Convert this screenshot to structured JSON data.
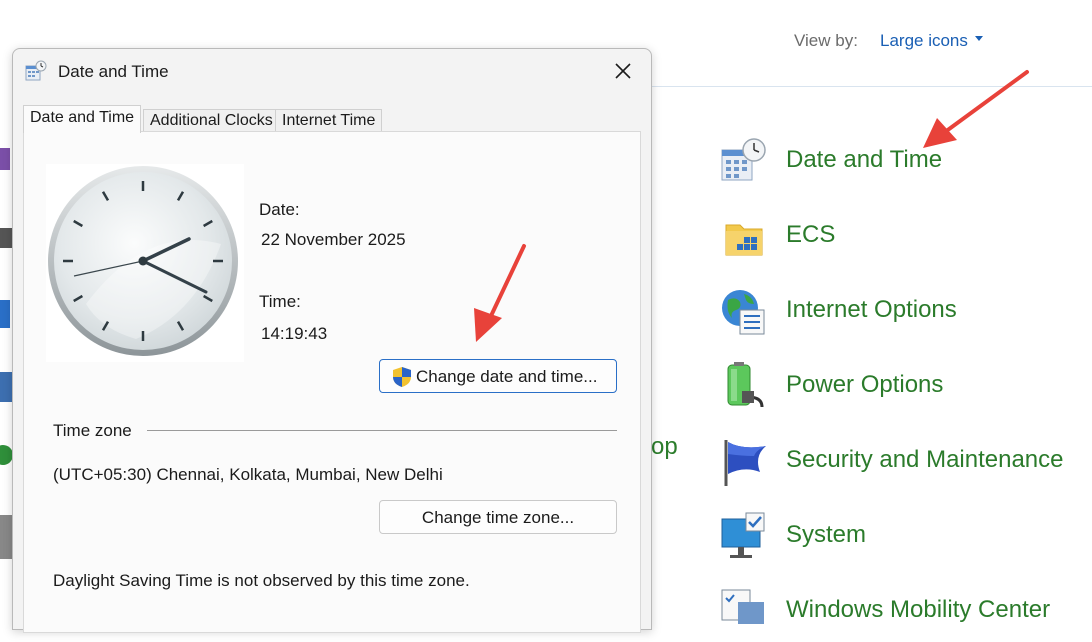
{
  "control_panel": {
    "view_by_label": "View by:",
    "view_by_value": "Large icons",
    "partial_label": "op",
    "items": [
      {
        "label": "Date and Time",
        "icon": "calendar-clock-icon"
      },
      {
        "label": "ECS",
        "icon": "folder-icon"
      },
      {
        "label": "Internet Options",
        "icon": "globe-icon"
      },
      {
        "label": "Power Options",
        "icon": "battery-icon"
      },
      {
        "label": "Security and Maintenance",
        "icon": "flag-icon"
      },
      {
        "label": "System",
        "icon": "monitor-icon"
      },
      {
        "label": "Windows Mobility Center",
        "icon": "mobility-icon"
      }
    ]
  },
  "dialog": {
    "title": "Date and Time",
    "tabs": [
      "Date and Time",
      "Additional Clocks",
      "Internet Time"
    ],
    "date_label": "Date:",
    "date_value": "22 November 2025",
    "time_label": "Time:",
    "time_value": "14:19:43",
    "change_button": "Change date and time...",
    "timezone_header": "Time zone",
    "timezone_value": "(UTC+05:30) Chennai, Kolkata, Mumbai, New Delhi",
    "timezone_button": "Change time zone...",
    "dst_text": "Daylight Saving Time is not observed by this time zone."
  },
  "colors": {
    "link_green": "#2b7b2b",
    "link_blue": "#1a5fb4",
    "annotation_red": "#e8423a"
  }
}
